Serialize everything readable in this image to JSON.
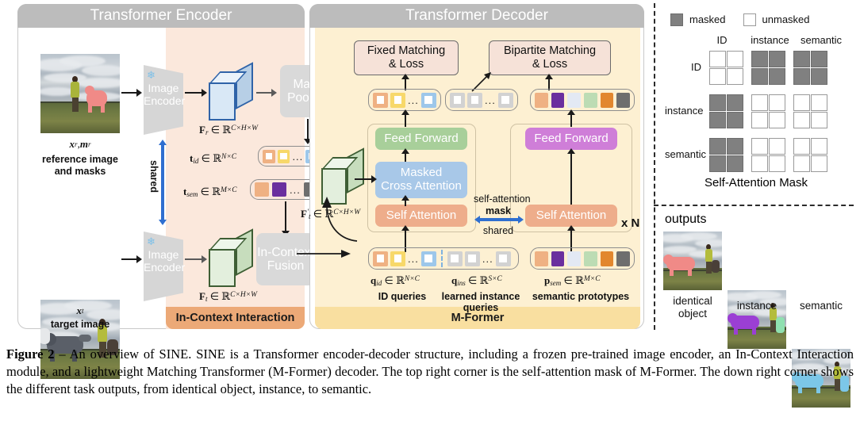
{
  "encoder": {
    "title": "Transformer Encoder",
    "ref_caption_math": "x_r , m_r",
    "ref_caption_line1": "reference image",
    "ref_caption_line2": "and masks",
    "tgt_caption_math": "x_t",
    "tgt_caption_line1": "target image",
    "image_encoder_line1": "Image",
    "image_encoder_line2": "Encoder",
    "shared_label": "shared",
    "mask_pooling_line1": "Mask",
    "mask_pooling_line2": "Pooling",
    "fusion_line1": "In-Context",
    "fusion_line2": "Fusion",
    "feat_ref_label": "F_r ∈ R^{C×H×W}",
    "feat_tgt_label": "F_t ∈ R^{C×H×W}",
    "t_id_label": "t_id ∈ R^{N×C}",
    "t_sem_label": "t_sem ∈ R^{M×C}",
    "footer": "In-Context Interaction",
    "snowflake_icon": "frozen-snowflake-icon"
  },
  "decoder": {
    "title": "Transformer Decoder",
    "fixed_matching_line1": "Fixed Matching",
    "fixed_matching_line2": "& Loss",
    "bipartite_matching_line1": "Bipartite Matching",
    "bipartite_matching_line2": "& Loss",
    "feed_forward_left": "Feed Forward",
    "feed_forward_right": "Feed Forward",
    "masked_cross_attention_line1": "Masked",
    "masked_cross_attention_line2": "Cross Attention",
    "self_attention_left": "Self Attention",
    "self_attention_right": "Self Attention",
    "self_attention_mask_line1": "self-attention",
    "self_attention_mask_line2": "mask",
    "self_attention_mask_line3": "shared",
    "repeat_label": "x N",
    "feat_tgt_prime_label": "F'_t ∈ R^{C×H×W}",
    "q_id_label": "q_id ∈ R^{N×C}",
    "q_ins_label": "q_ins ∈ R^{S×C}",
    "p_sem_label": "p_sem ∈ R^{M×C}",
    "q_id_caption": "ID queries",
    "q_ins_caption_line1": "learned instance",
    "q_ins_caption_line2": "queries",
    "p_sem_caption": "semantic prototypes",
    "footer": "M-Former"
  },
  "tokens": {
    "id_colors": [
      "#efb183",
      "#f7d86a",
      "#9dc7ea"
    ],
    "ins_colors": [
      "#d2d2d2",
      "#d2d2d2",
      "#d2d2d2"
    ],
    "sem_colors": [
      "#efb183",
      "#6a2f9e",
      "#e3e9f4",
      "#bcdcb4",
      "#e2872e",
      "#6e6e6e"
    ],
    "ellipsis": "..."
  },
  "mask_legend": {
    "masked_label": "masked",
    "unmasked_label": "unmasked",
    "masked_color": "#808080",
    "unmasked_color": "#ffffff"
  },
  "mask_matrix": {
    "title": "Self-Attention Mask",
    "col_headers": [
      "ID",
      "instance",
      "semantic"
    ],
    "row_headers": [
      "ID",
      "instance",
      "semantic"
    ],
    "blocks": [
      [
        "unmasked",
        "masked",
        "masked"
      ],
      [
        "masked",
        "unmasked",
        "unmasked"
      ],
      [
        "masked",
        "unmasked",
        "unmasked"
      ]
    ],
    "block_size": 2
  },
  "outputs": {
    "title": "outputs",
    "items": [
      {
        "caption_line1": "identical",
        "caption_line2": "object",
        "mask_color": "#f08a87"
      },
      {
        "caption_line1": "instance",
        "caption_line2": "",
        "mask_color": "#9b3fd4"
      },
      {
        "caption_line1": "semantic",
        "caption_line2": "",
        "mask_color": "#7cc7e8"
      }
    ],
    "second_mask_color": "#8fe0b0"
  },
  "caption": {
    "figure_label": "Figure 2",
    "dash": " – ",
    "text": "An overview of SINE. SINE is a Transformer encoder-decoder structure, including a frozen pre-trained image encoder, an In-Context Interaction module, and a lightweight Matching Transformer (M-Former) decoder. The top right corner is the self-attention mask of M-Former. The down right corner shows the different task outputs, from identical object, instance, to semantic."
  }
}
